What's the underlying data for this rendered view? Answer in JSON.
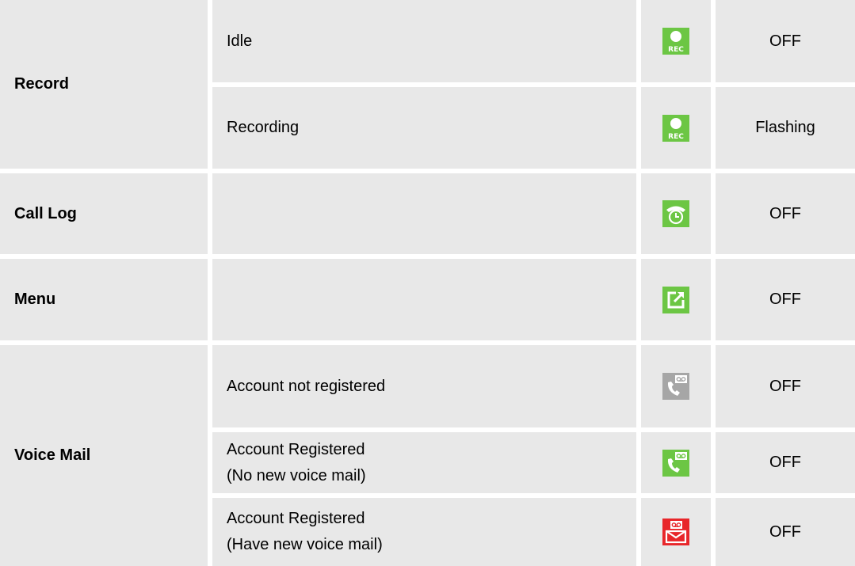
{
  "rows": [
    {
      "label": "Record",
      "states": [
        {
          "desc": "Idle",
          "icon": "rec-icon",
          "icon_color": "#6cc644",
          "status": "OFF"
        },
        {
          "desc": "Recording",
          "icon": "rec-icon",
          "icon_color": "#6cc644",
          "status": "Flashing"
        }
      ]
    },
    {
      "label": "Call Log",
      "states": [
        {
          "desc": "",
          "icon": "call-log-icon",
          "icon_color": "#6cc644",
          "status": "OFF"
        }
      ]
    },
    {
      "label": "Menu",
      "states": [
        {
          "desc": "",
          "icon": "menu-icon",
          "icon_color": "#6cc644",
          "status": "OFF"
        }
      ]
    },
    {
      "label": "Voice Mail",
      "states": [
        {
          "desc": "Account not registered",
          "icon": "voicemail-gray-icon",
          "icon_color": "#a6a6a6",
          "status": "OFF"
        },
        {
          "desc_lines": [
            "Account Registered",
            "(No new voice mail)"
          ],
          "icon": "voicemail-green-icon",
          "icon_color": "#6cc644",
          "status": "OFF"
        },
        {
          "desc_lines": [
            "Account Registered",
            "(Have new voice mail)"
          ],
          "icon": "voicemail-red-icon",
          "icon_color": "#e8262a",
          "status": "OFF"
        }
      ]
    }
  ]
}
